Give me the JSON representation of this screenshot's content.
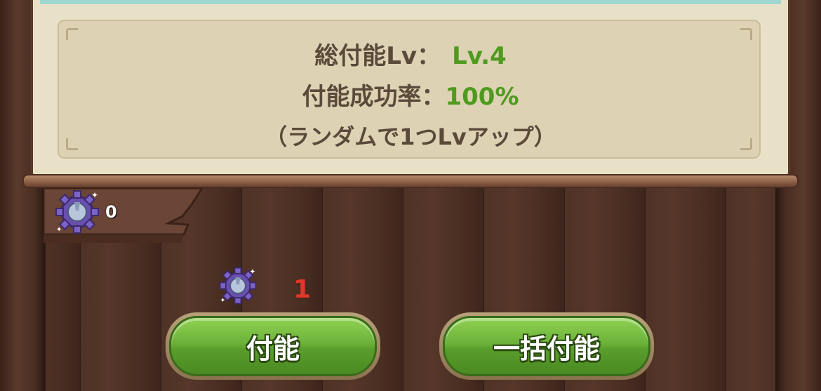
{
  "panel": {
    "total_label": "総付能Lv：",
    "total_value": "Lv.4",
    "rate_label": "付能成功率：",
    "rate_value": "100%",
    "note": "（ランダムで1つLvアップ）"
  },
  "currency": {
    "icon": "enchant-gear-icon",
    "owned": "0"
  },
  "cost": {
    "icon": "enchant-gear-icon",
    "amount": "1"
  },
  "buttons": {
    "enchant": "付能",
    "bulk_enchant": "一括付能"
  },
  "colors": {
    "value_green": "#4f9a1f",
    "cost_red": "#e0392a",
    "button_green": "#6cb23a"
  }
}
